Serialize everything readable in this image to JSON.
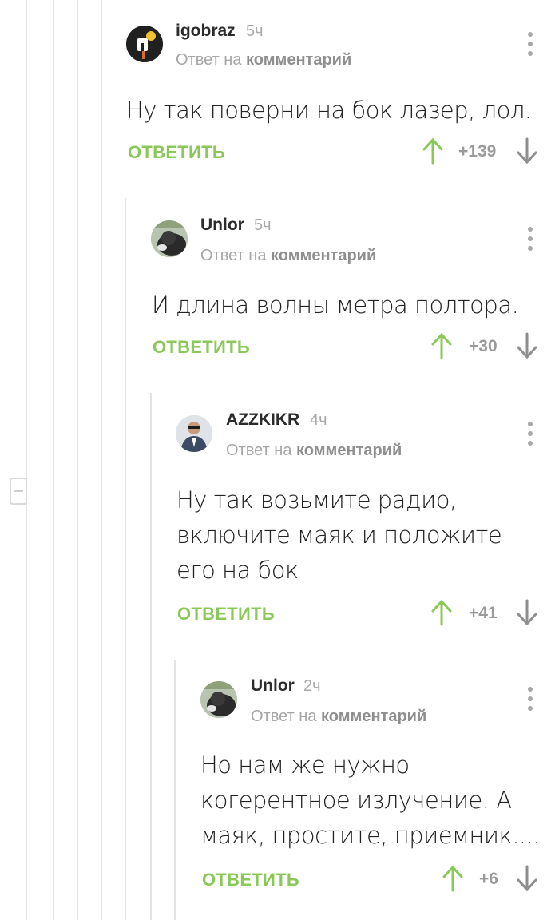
{
  "reply_prefix": "Ответ на",
  "reply_target": "комментарий",
  "reply_label": "ОТВЕТИТЬ",
  "comments": [
    {
      "username": "igobraz",
      "time": "5ч",
      "text": "Ну так поверни на бок лазер, лол.",
      "rating": "+139"
    },
    {
      "username": "Unlor",
      "time": "5ч",
      "text": "И длина волны метра полтора.",
      "rating": "+30"
    },
    {
      "username": "AZZKIKR",
      "time": "4ч",
      "text_lines": [
        "Ну так возьмите радио,",
        "включите маяк и положите",
        "его на бок"
      ],
      "rating": "+41"
    },
    {
      "username": "Unlor",
      "time": "2ч",
      "text_lines": [
        "Но нам же нужно",
        "когерентное излучение. А",
        "маяк, простите, приемник...."
      ],
      "rating": "+6"
    }
  ],
  "colors": {
    "accent_green": "#8ac858",
    "muted_text": "#a6a6a6",
    "thread_line": "#e3e3e3"
  }
}
